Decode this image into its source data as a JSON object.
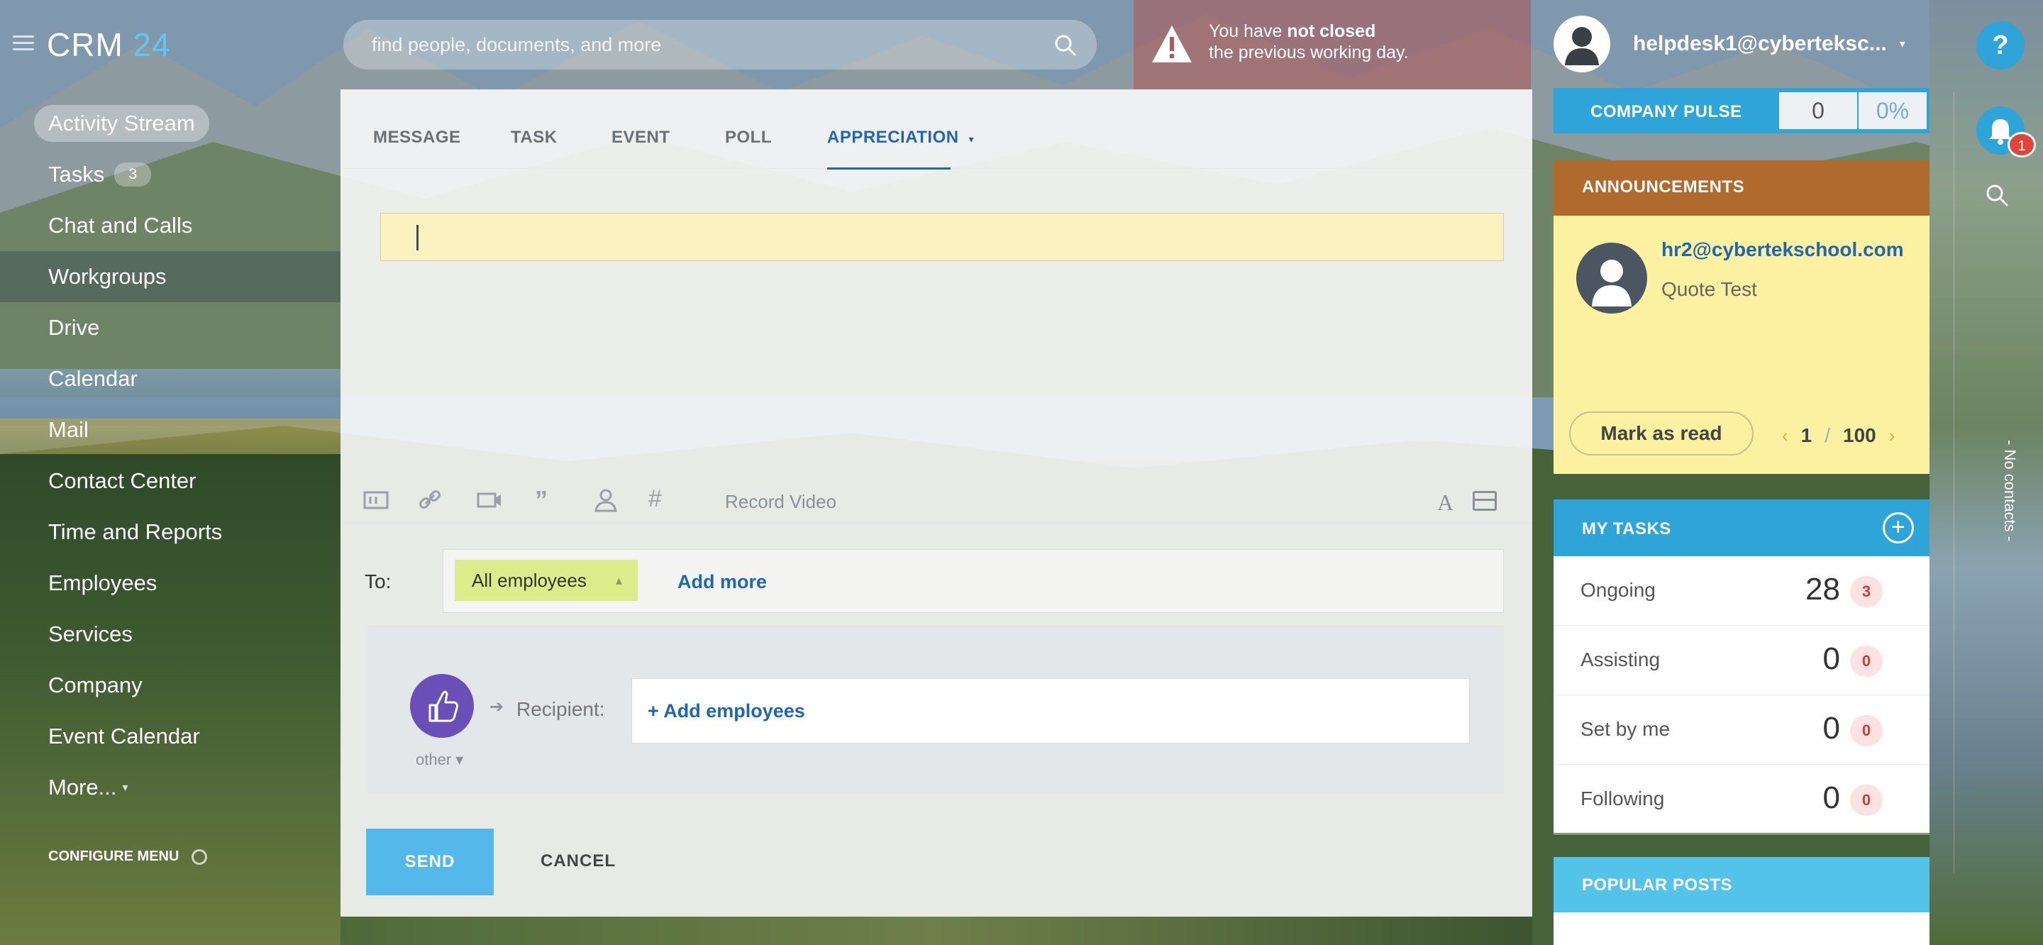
{
  "app": {
    "logo_text": "CRM",
    "logo_num": "24"
  },
  "sidebar": {
    "items": [
      {
        "label": "Activity Stream"
      },
      {
        "label": "Tasks",
        "badge": "3"
      },
      {
        "label": "Chat and Calls"
      },
      {
        "label": "Workgroups"
      },
      {
        "label": "Drive"
      },
      {
        "label": "Calendar"
      },
      {
        "label": "Mail"
      },
      {
        "label": "Contact Center"
      },
      {
        "label": "Time and Reports"
      },
      {
        "label": "Employees"
      },
      {
        "label": "Services"
      },
      {
        "label": "Company"
      },
      {
        "label": "Event Calendar"
      },
      {
        "label": "More..."
      }
    ],
    "configure": "CONFIGURE MENU"
  },
  "search": {
    "placeholder": "find people, documents, and more"
  },
  "alert": {
    "pre": "You have ",
    "bold": "not closed",
    "line2": "the previous working day."
  },
  "user": {
    "name": "helpdesk1@cyberteksc..."
  },
  "right_strip": {
    "help": "?",
    "bell_count": "1",
    "no_contacts": "- No contacts -"
  },
  "composer": {
    "tabs": [
      "MESSAGE",
      "TASK",
      "EVENT",
      "POLL",
      "APPRECIATION"
    ],
    "active_tab": "APPRECIATION",
    "message_value": "",
    "record_video": "Record Video",
    "to_label": "To:",
    "to_chip": "All employees",
    "add_more": "Add more",
    "appreciation_type": "other",
    "recipient_label": "Recipient:",
    "add_employees": "+ Add employees",
    "send": "SEND",
    "cancel": "CANCEL"
  },
  "pulse": {
    "label": "COMPANY PULSE",
    "value": "0",
    "percent": "0%"
  },
  "announcements": {
    "title": "ANNOUNCEMENTS",
    "author": "hr2@cybertekschool.com",
    "text": "Quote Test",
    "mark_read": "Mark as read",
    "page_current": "1",
    "page_sep": "/",
    "page_total": "100"
  },
  "my_tasks": {
    "title": "MY TASKS",
    "rows": [
      {
        "label": "Ongoing",
        "value": "28",
        "count": "3"
      },
      {
        "label": "Assisting",
        "value": "0",
        "count": "0"
      },
      {
        "label": "Set by me",
        "value": "0",
        "count": "0"
      },
      {
        "label": "Following",
        "value": "0",
        "count": "0"
      }
    ]
  },
  "popular_posts": {
    "title": "POPULAR POSTS"
  },
  "colors": {
    "accent": "#2ea4d8",
    "link": "#2066b0",
    "send": "#54b9ea",
    "appreciation": "#6b4fb8",
    "alert": "#e2443c"
  }
}
